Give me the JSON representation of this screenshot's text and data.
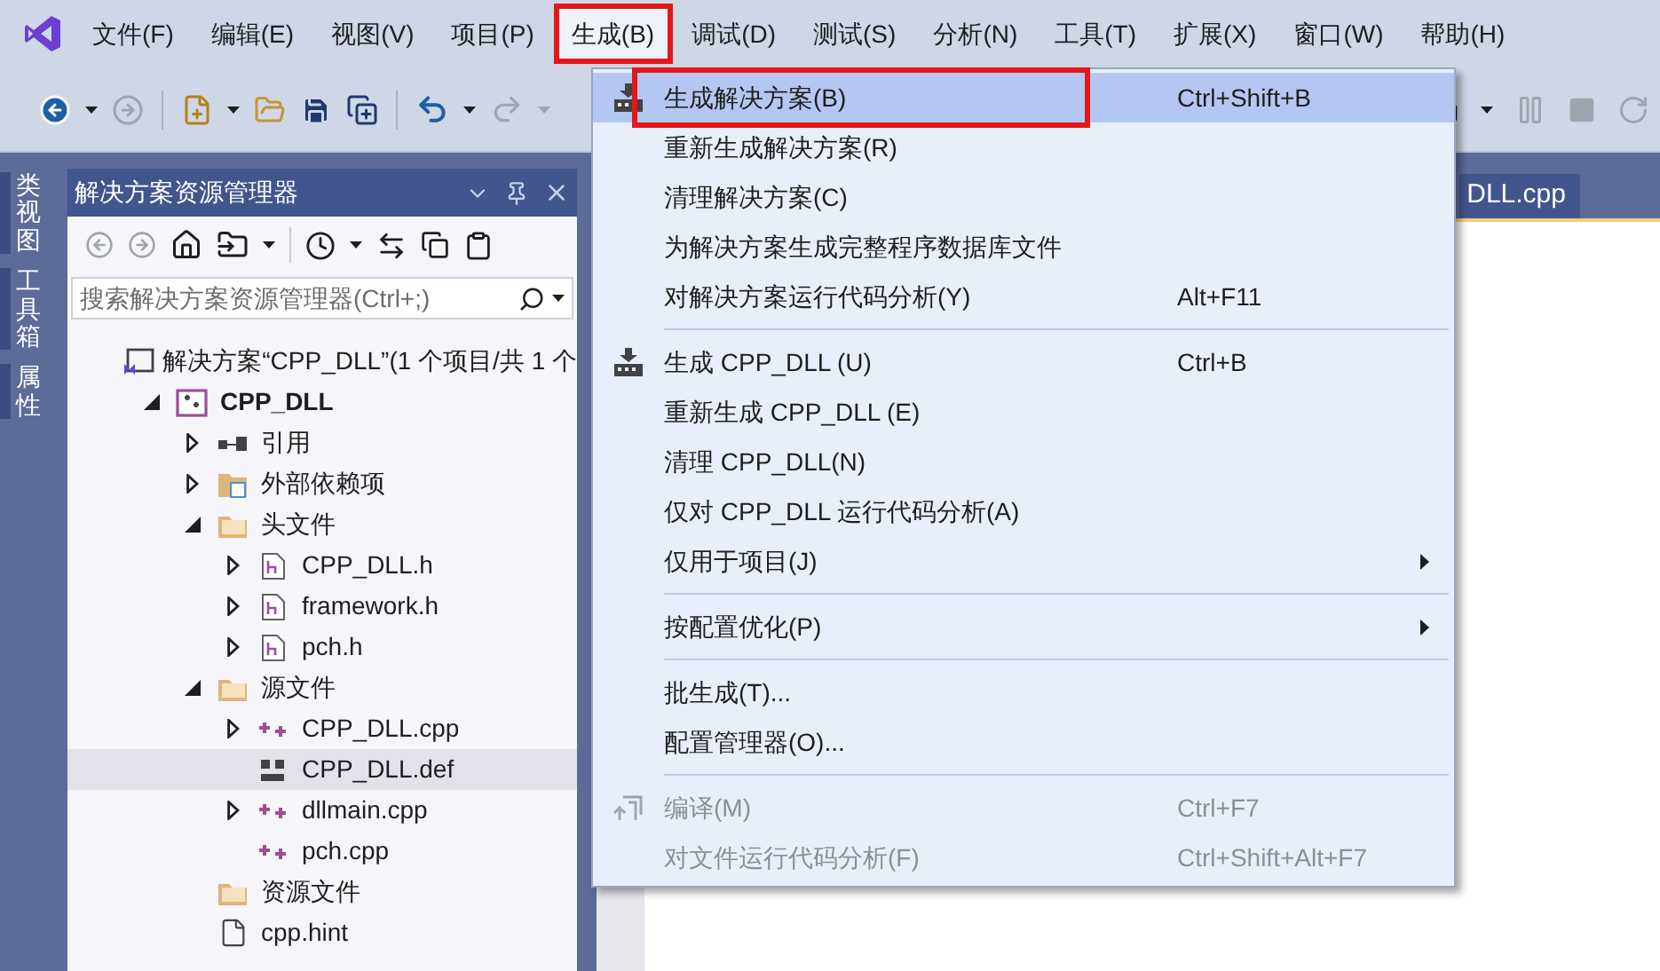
{
  "menubar": [
    {
      "label": "文件(F)",
      "selected": false
    },
    {
      "label": "编辑(E)",
      "selected": false
    },
    {
      "label": "视图(V)",
      "selected": false
    },
    {
      "label": "项目(P)",
      "selected": false
    },
    {
      "label": "生成(B)",
      "selected": true
    },
    {
      "label": "调试(D)",
      "selected": false
    },
    {
      "label": "测试(S)",
      "selected": false
    },
    {
      "label": "分析(N)",
      "selected": false
    },
    {
      "label": "工具(T)",
      "selected": false
    },
    {
      "label": "扩展(X)",
      "selected": false
    },
    {
      "label": "窗口(W)",
      "selected": false
    },
    {
      "label": "帮助(H)",
      "selected": false
    }
  ],
  "side_tabs": [
    "类视图",
    "工具箱",
    "属性"
  ],
  "solution_explorer": {
    "title": "解决方案资源管理器",
    "search": {
      "placeholder": "搜索解决方案资源管理器(Ctrl+;)"
    },
    "tree": [
      {
        "label": "解决方案“CPP_DLL”(1 个项目/共 1 个",
        "kind": "solution",
        "selected": false,
        "children": [
          {
            "label": "CPP_DLL",
            "kind": "project",
            "expanded": true,
            "selected": false,
            "children": [
              {
                "label": "引用",
                "kind": "references",
                "expanded": false,
                "selected": false
              },
              {
                "label": "外部依赖项",
                "kind": "dependencies",
                "expanded": false,
                "selected": false
              },
              {
                "label": "头文件",
                "kind": "folder",
                "expanded": true,
                "selected": false,
                "children": [
                  {
                    "label": "CPP_DLL.h",
                    "kind": "header",
                    "expanded": false,
                    "selected": false
                  },
                  {
                    "label": "framework.h",
                    "kind": "header",
                    "expanded": false,
                    "selected": false
                  },
                  {
                    "label": "pch.h",
                    "kind": "header",
                    "expanded": false,
                    "selected": false
                  }
                ]
              },
              {
                "label": "源文件",
                "kind": "folder",
                "expanded": true,
                "selected": false,
                "children": [
                  {
                    "label": "CPP_DLL.cpp",
                    "kind": "cpp",
                    "expanded": false,
                    "selected": false
                  },
                  {
                    "label": "CPP_DLL.def",
                    "kind": "def",
                    "selected": true
                  },
                  {
                    "label": "dllmain.cpp",
                    "kind": "cpp",
                    "expanded": false,
                    "selected": false
                  },
                  {
                    "label": "pch.cpp",
                    "kind": "cpp",
                    "selected": false
                  }
                ]
              },
              {
                "label": "资源文件",
                "kind": "folder",
                "selected": false
              },
              {
                "label": "cpp.hint",
                "kind": "file",
                "selected": false
              }
            ]
          }
        ]
      }
    ]
  },
  "editor": {
    "tab": "DLL.cpp"
  },
  "build_menu": [
    {
      "kind": "build",
      "label": "生成解决方案(B)",
      "shortcut": "Ctrl+Shift+B",
      "selected": true,
      "disabled": false
    },
    {
      "kind": "item",
      "label": "重新生成解决方案(R)",
      "selected": false,
      "disabled": false
    },
    {
      "kind": "item",
      "label": "清理解决方案(C)",
      "selected": false,
      "disabled": false
    },
    {
      "kind": "item",
      "label": "为解决方案生成完整程序数据库文件",
      "selected": false,
      "disabled": false
    },
    {
      "kind": "item",
      "label": "对解决方案运行代码分析(Y)",
      "shortcut": "Alt+F11",
      "selected": false,
      "disabled": false
    },
    {
      "kind": "separator"
    },
    {
      "kind": "build",
      "label": "生成 CPP_DLL (U)",
      "shortcut": "Ctrl+B",
      "selected": false,
      "disabled": false
    },
    {
      "kind": "item",
      "label": "重新生成 CPP_DLL (E)",
      "selected": false,
      "disabled": false
    },
    {
      "kind": "item",
      "label": "清理 CPP_DLL(N)",
      "selected": false,
      "disabled": false
    },
    {
      "kind": "item",
      "label": "仅对 CPP_DLL 运行代码分析(A)",
      "selected": false,
      "disabled": false
    },
    {
      "kind": "submenu",
      "label": "仅用于项目(J)",
      "selected": false,
      "disabled": false
    },
    {
      "kind": "separator"
    },
    {
      "kind": "submenu",
      "label": "按配置优化(P)",
      "selected": false,
      "disabled": false
    },
    {
      "kind": "separator"
    },
    {
      "kind": "item",
      "label": "批生成(T)...",
      "selected": false,
      "disabled": false
    },
    {
      "kind": "item",
      "label": "配置管理器(O)...",
      "selected": false,
      "disabled": false
    },
    {
      "kind": "separator"
    },
    {
      "kind": "compile",
      "label": "编译(M)",
      "shortcut": "Ctrl+F7",
      "selected": false,
      "disabled": true
    },
    {
      "kind": "item",
      "label": "对文件运行代码分析(F)",
      "shortcut": "Ctrl+Shift+Alt+F7",
      "selected": false,
      "disabled": true
    }
  ]
}
